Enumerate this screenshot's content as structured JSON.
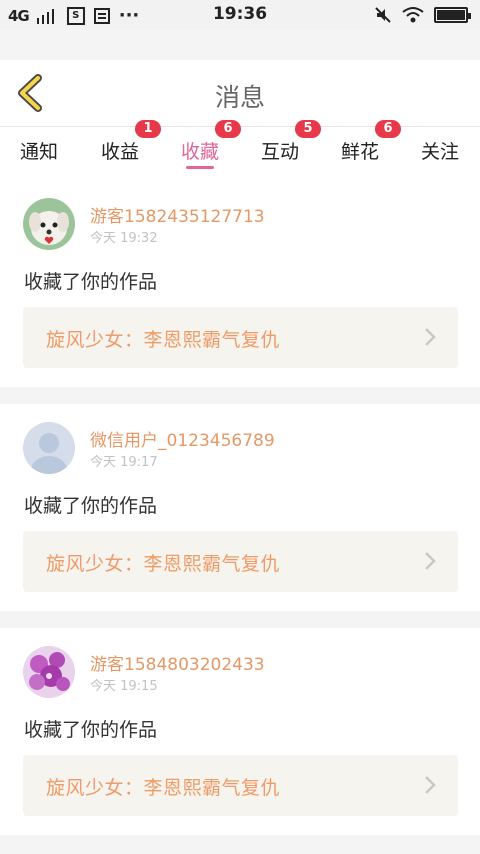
{
  "status_bar": {
    "signal": "4G",
    "time": "19:36",
    "battery_level": 1.0
  },
  "header": {
    "title": "消息",
    "back_icon": "chevron-left-icon",
    "back_icon_color": "#f5d64a"
  },
  "tabs": [
    {
      "label": "通知",
      "badge": ""
    },
    {
      "label": "收益",
      "badge": "1"
    },
    {
      "label": "收藏",
      "badge": "6",
      "active": true
    },
    {
      "label": "互动",
      "badge": "5"
    },
    {
      "label": "鲜花",
      "badge": "6"
    },
    {
      "label": "关注",
      "badge": ""
    }
  ],
  "messages": [
    {
      "user": "游客1582435127713",
      "time": "今天 19:32",
      "action": "收藏了你的作品",
      "work": "旋风少女：李恩熙霸气复仇",
      "avatar": "puppy-avatar"
    },
    {
      "user": "微信用户_0123456789",
      "time": "今天 19:17",
      "action": "收藏了你的作品",
      "work": "旋风少女：李恩熙霸气复仇",
      "avatar": "default-person-avatar"
    },
    {
      "user": "游客1584803202433",
      "time": "今天 19:15",
      "action": "收藏了你的作品",
      "work": "旋风少女：李恩熙霸气复仇",
      "avatar": "purple-flowers-avatar"
    }
  ],
  "colors": {
    "accent": "#e0679c",
    "badge": "#e8394a",
    "username": "#e59866",
    "work_title": "#ef9b66"
  }
}
